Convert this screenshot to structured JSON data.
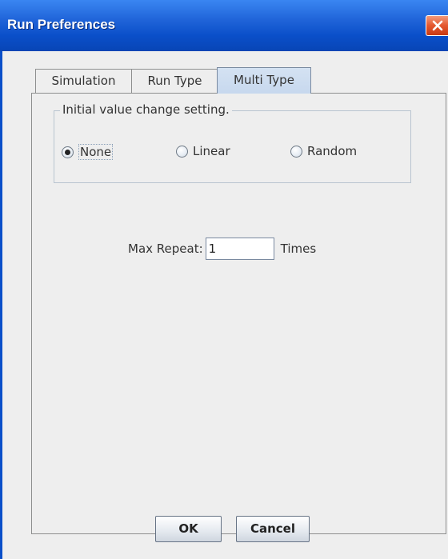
{
  "window": {
    "title": "Run Preferences"
  },
  "tabs": [
    {
      "label": "Simulation",
      "selected": false
    },
    {
      "label": "Run Type",
      "selected": false
    },
    {
      "label": "Multi Type",
      "selected": true
    }
  ],
  "group": {
    "legend": "Initial value change setting.",
    "options": [
      {
        "label": "None",
        "checked": true
      },
      {
        "label": "Linear",
        "checked": false
      },
      {
        "label": "Random",
        "checked": false
      }
    ]
  },
  "max_repeat": {
    "label": "Max Repeat:",
    "value": "1",
    "unit": "Times"
  },
  "buttons": {
    "ok": "OK",
    "cancel": "Cancel"
  },
  "colors": {
    "titlebar": "#0a4fc9",
    "close": "#e4572f",
    "selected_tab": "#c7d8ee"
  },
  "icons": {
    "close": "close-icon"
  }
}
